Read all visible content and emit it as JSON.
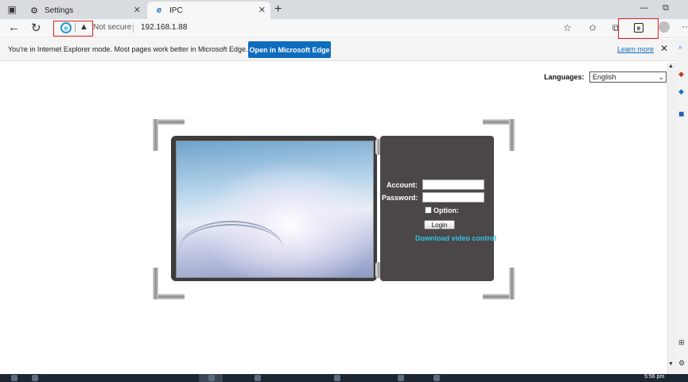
{
  "tabs": [
    {
      "title": "Settings",
      "icon": "gear-icon",
      "active": false
    },
    {
      "title": "IPC",
      "icon": "ie-icon",
      "active": true
    }
  ],
  "address_bar": {
    "security_text": "Not secure",
    "url": "192.168.1.88"
  },
  "infobar": {
    "message": "You're in Internet Explorer mode. Most pages work better in Microsoft Edge.",
    "open_button": "Open in Microsoft Edge",
    "learn_more": "Learn more"
  },
  "page": {
    "languages_label": "Languages:",
    "language_selected": "English",
    "account_label": "Account:",
    "password_label": "Password:",
    "option_label": "Option:",
    "login_button": "Login",
    "download_link": "Download video control"
  },
  "taskbar": {
    "clock": "5:56 pm"
  },
  "colors": {
    "edge_blue": "#0f6cbd",
    "highlight_red": "#e01f1f",
    "link_cyan": "#2ec4e6",
    "login_panel": "#4b4748"
  }
}
